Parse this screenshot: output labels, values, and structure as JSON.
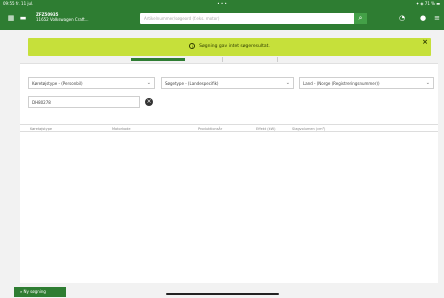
{
  "statusbar": {
    "left": "09:55 fr. 11 jul.",
    "center": "• • •",
    "right": "✦ ◈ 71 % ▬"
  },
  "appbar": {
    "vehicle_reg": "ZFZ50935",
    "vehicle_name": "Volkswagen Craft...",
    "vehicle_code": "11652",
    "search_placeholder": "Artikelnummer/søgeord (f.eks. motor)"
  },
  "toast": {
    "message": "Søgning gav intet søgeresultat."
  },
  "filters": {
    "manufacturer_type": "Køretøjstype - (Personbil)",
    "search_type": "Søgetype - (Landespecifik)",
    "country": "Land - (Norge (Registreringsnummer))",
    "reg_input": "DH80278"
  },
  "table": {
    "headers": [
      "Køretøjstype",
      "Motorkode",
      "Produktionsår",
      "Effekt (kW)",
      "Slagvolumen (cm³)"
    ]
  },
  "bottom_button": {
    "label": "Ny søgning"
  }
}
